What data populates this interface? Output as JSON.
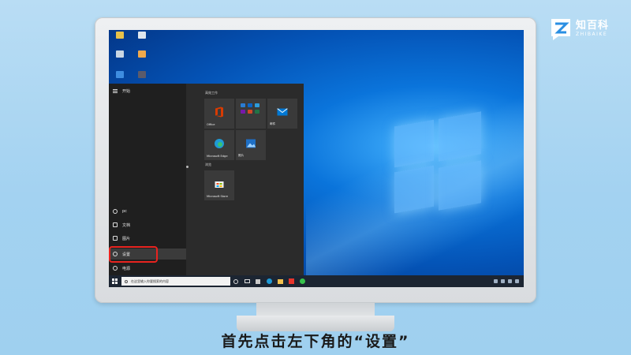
{
  "brand": {
    "name_cn": "知百科",
    "name_en": "ZHIBAIKE"
  },
  "caption": "首先点击左下角的“设置”",
  "start_menu": {
    "header": "开始",
    "user": "pc",
    "documents": "文档",
    "pictures": "图片",
    "settings": "设置",
    "power": "电源",
    "group1": "高效工作",
    "group2": "浏览",
    "tiles": {
      "office": "Office",
      "mail": "邮件",
      "edge": "Microsoft Edge",
      "photos": "照片",
      "store": "Microsoft Store"
    }
  },
  "taskbar": {
    "search_placeholder": "在这里输入你要搜索的内容"
  },
  "colors": {
    "highlight": "#e8231f",
    "taskbar": "#1c2532",
    "office": "#d83b01",
    "mail": "#0078d4"
  }
}
